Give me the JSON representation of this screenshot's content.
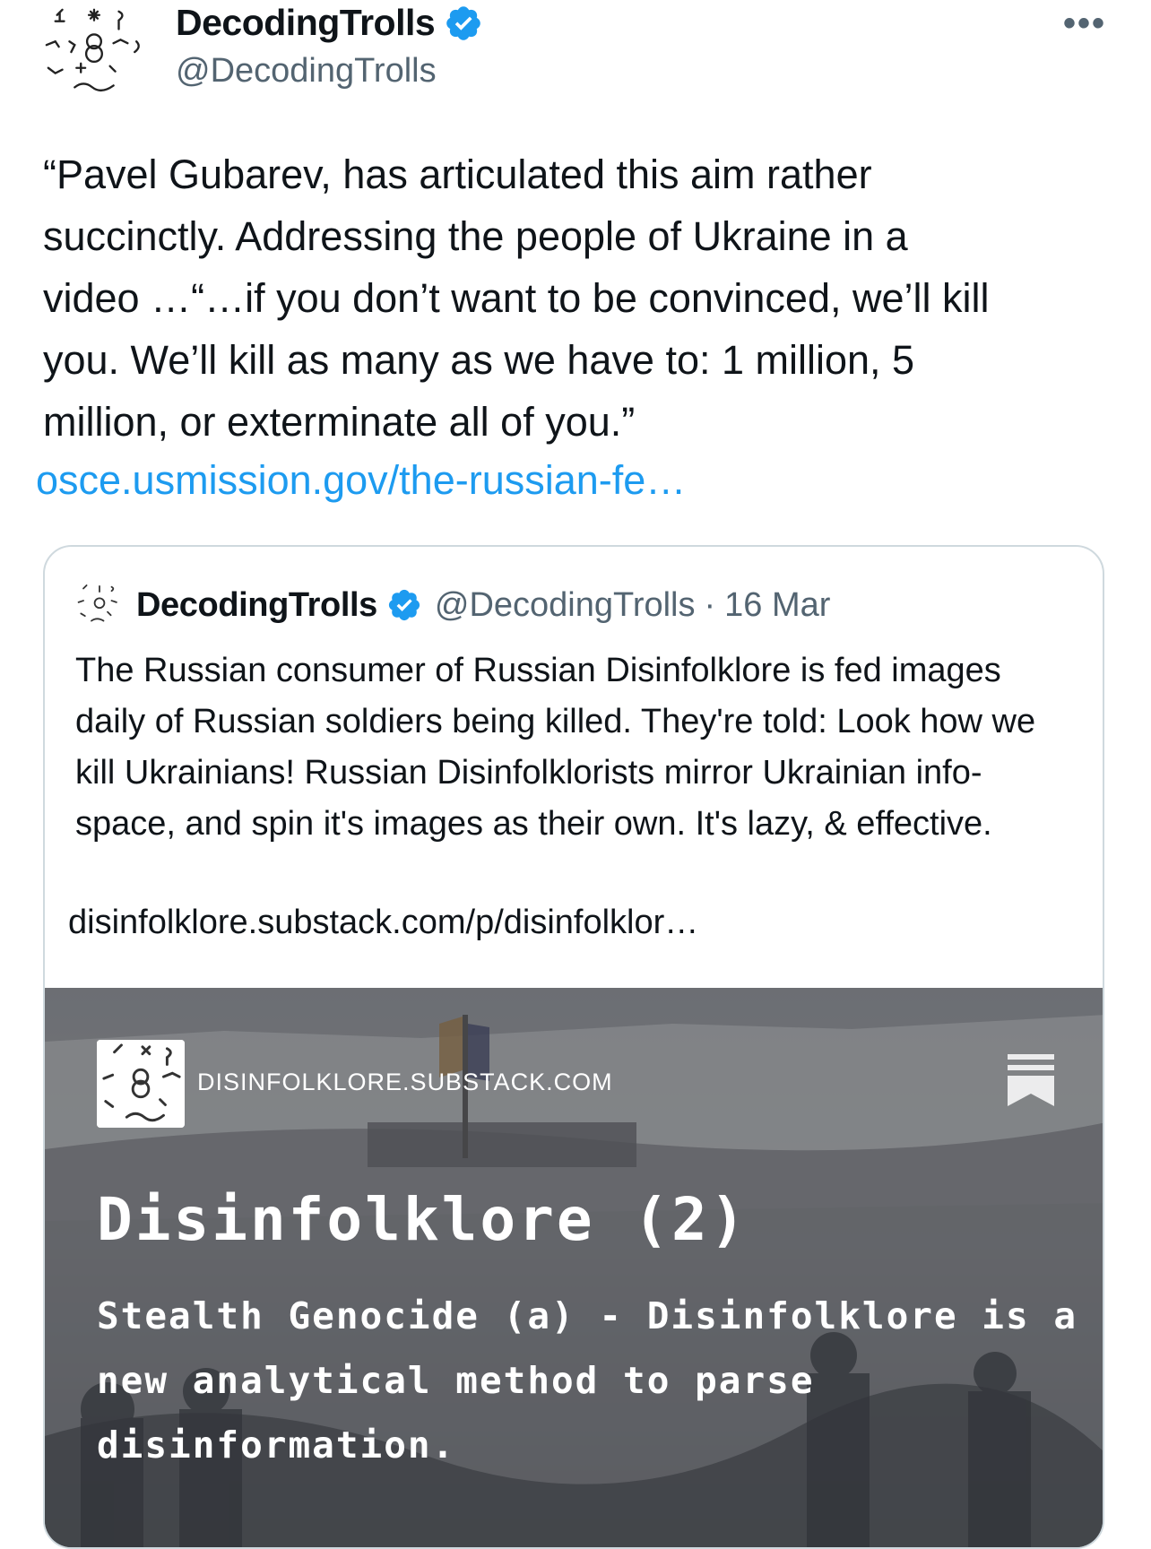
{
  "author": {
    "name": "DecodingTrolls",
    "handle": "@DecodingTrolls",
    "more_label": "•••"
  },
  "tweet": {
    "text": "“Pavel Gubarev, has articulated this aim rather\nsuccinctly.  Addressing the people of Ukraine in a\nvideo …“…if you don’t want to be convinced, we’ll kill\nyou. We’ll kill as many as we have to: 1 million, 5\nmillion, or exterminate all of you.”",
    "link": "osce.usmission.gov/the-russian-fe…"
  },
  "quote": {
    "name": "DecodingTrolls",
    "handle": "@DecodingTrolls",
    "dot": "·",
    "date": "16 Mar",
    "text": "The Russian consumer of Russian Disinfolklore is fed images daily of Russian soldiers being killed. They're told: Look how we kill Ukrainians! Russian Disinfolklorists mirror Ukrainian info-space, and spin it's images as their own. It's lazy, & effective.",
    "link": "disinfolklore.substack.com/p/disinfolklor…",
    "card": {
      "domain": "DISINFOLKLORE.SUBSTACK.COM",
      "title": "Disinfolklore (2)",
      "subtitle": "Stealth Genocide (a) - Disinfolklore is a new analytical method to parse disinformation."
    }
  },
  "colors": {
    "link": "#1d9bf0",
    "verified": "#1d9bf0",
    "muted": "#536471",
    "border": "#cfd9de"
  },
  "icons": {
    "verified": "verified-badge-icon",
    "more": "more-icon",
    "bookmark": "substack-bookmark-icon"
  }
}
